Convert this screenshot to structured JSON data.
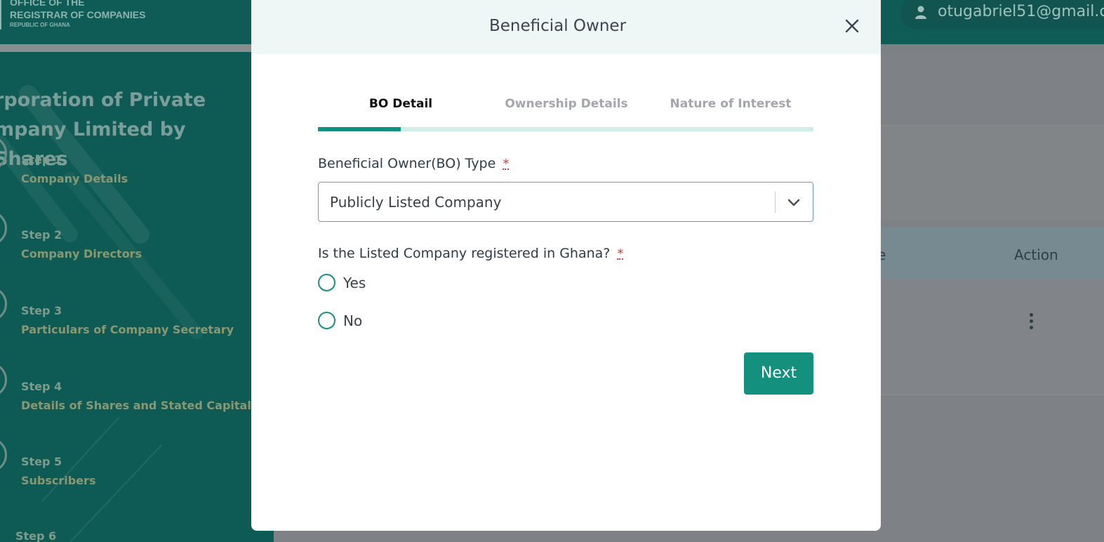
{
  "header": {
    "logo_lines": [
      "OFFICE OF THE",
      "REGISTRAR OF COMPANIES"
    ],
    "logo_sub": "REPUBLIC OF GHANA",
    "user_email": "otugabriel51@gmail.c"
  },
  "sidebar": {
    "title_line1": "rporation of Private",
    "title_line2": "mpany Limited by Shares",
    "steps": [
      {
        "num": "Step 1",
        "name": "Company Details"
      },
      {
        "num": "Step 2",
        "name": "Company Directors"
      },
      {
        "num": "Step 3",
        "name": "Particulars of Company Secretary"
      },
      {
        "num": "Step 4",
        "name": "Details of Shares and Stated Capital"
      },
      {
        "num": "Step 5",
        "name": "Subscribers"
      },
      {
        "num": "Step 6",
        "name": ""
      }
    ]
  },
  "table": {
    "header_partial": "e",
    "header_action": "Action"
  },
  "modal": {
    "title": "Beneficial Owner",
    "tabs": [
      "BO Detail",
      "Ownership Details",
      "Nature of Interest"
    ],
    "active_tab_index": 0,
    "progress_fraction": 0.1667,
    "bo_type_label": "Beneficial Owner(BO) Type",
    "required_mark": "*",
    "bo_type_value": "Publicly Listed Company",
    "question_label": "Is the Listed Company registered in Ghana?",
    "options": [
      "Yes",
      "No"
    ],
    "next_label": "Next"
  },
  "colors": {
    "primary": "#14907e",
    "header_bg": "#0f5c56",
    "modal_header_bg": "#eff7f6",
    "required": "#d43b3b"
  }
}
